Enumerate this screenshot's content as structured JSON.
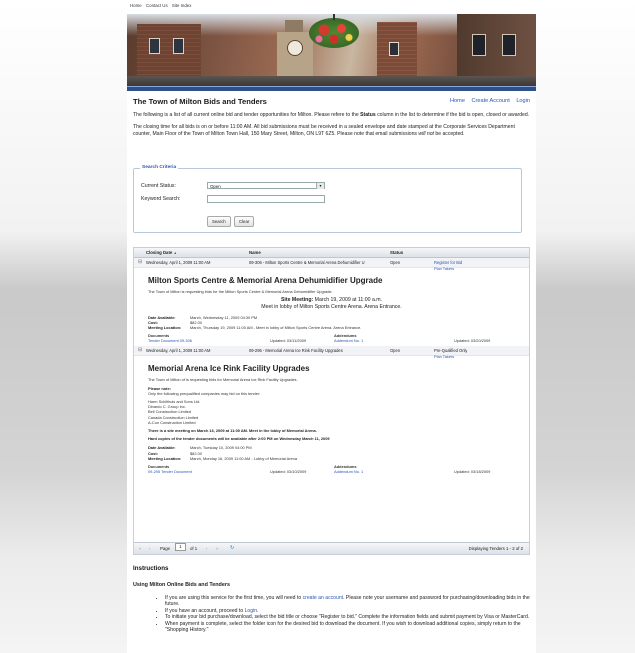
{
  "topnav": [
    "Home",
    "Contact Us",
    "Site Index"
  ],
  "page": {
    "title": "The Town of Milton Bids and Tenders",
    "links": [
      "Home",
      "Create Account",
      "Login"
    ],
    "intro1_before": "The following is a list of all current online bid and tender opportunities for Milton.  Please refere to the ",
    "intro1_bold": "Status",
    "intro1_after": " column in the list to determine if the bid is open, closed or awarded.",
    "intro2_before": "The closing time for all bids is on or before 11:00 AM.  All bid submissions must be received in a sealed envelope and date stamped at the Corporate Services Department counter, Main Floor of the Town of Milton Town Hall, 150 Mary Street, Milton, ON  L9T 6Z5.  Please note that email submissions ",
    "intro2_em": "will not",
    "intro2_after": " be accepted."
  },
  "search": {
    "legend": "Search Criteria",
    "status_label": "Current Status:",
    "status_value": "Open",
    "keyword_label": "Keyword Search:",
    "keyword_value": "",
    "search_btn": "Search",
    "clear_btn": "Clear"
  },
  "grid": {
    "columns": [
      "Closing Date",
      "Name",
      "Status",
      ""
    ],
    "sort_indicator": "▲"
  },
  "tenders": [
    {
      "closing": "Wednesday, April 1, 2009 11:00 AM",
      "name": "09-306 - Milton Sports Centre & Memorial Arena Dehumidifier U",
      "status": "Open",
      "action1": "Register for Bid",
      "action2": "Plan Takers",
      "title": "Milton Sports Centre & Memorial Arena Dehumidifier Upgrade",
      "description": "The Town of Milton is requesting bids for the Milton Sports Centre & Memorial Arena Dehumidifier Upgrade.",
      "meeting_label": "Site Meeting:",
      "meeting_when": "March 19, 2009 at 11:00 a.m.",
      "meeting_where": "Meet in lobby of Milton Sports Centre Arena.  Arena Entrance.",
      "date_available_label": "Date Available:",
      "date_available": "March, Wednesday 11, 2009 04:30 PM",
      "cost_label": "Cost:",
      "cost": "$82.00",
      "meeting_location_label": "Meeting Location:",
      "meeting_location": "March, Thursday 19, 2009 11:00 AM  -  Meet in lobby of Milton Sports Centre Arena. Arena Entrance.",
      "documents_label": "Documents",
      "document": "Tender Document 09-306",
      "doc_updated": "Updated: 03/11/2009",
      "addendums_label": "Addendums",
      "addendum": "Addendum No. 1",
      "add_updated": "Updated: 03/20/2009"
    },
    {
      "closing": "Wednesday, April 1, 2009 11:00 AM",
      "name": "09-295 - Memorial Arena Ice Rink Facility Upgrades",
      "status": "Open",
      "action1": "Pre-Qualified Only",
      "action2": "Plan Takers",
      "title": "Memorial Arena Ice Rink Facility Upgrades",
      "description": "The Town of Milton of is requesting bids for Memorial Arena Ice Rink Facility Upgrades.",
      "please_note": "Please note:",
      "prequal_line": "Only the following prequalified companies may bid on this tender:",
      "companies": [
        "Harm Schilthuis and Sons Ltd.",
        "Dinardo C. Group Inc.",
        "Bell Construction Limited",
        "Canada Construction Limited",
        "A-Con Construction Limited"
      ],
      "note1": "There is a site meeting on March 16, 2009 at 11:00 AM.  Meet in the lobby of Memorial Arena.",
      "note2": "Hard copies of the tender documents will be available after 2:00 PM on Wednesday March 11, 2009",
      "date_available_label": "Date Available:",
      "date_available": "March, Tuesday 10, 2009 04:00 PM",
      "cost_label": "Cost:",
      "cost": "$82.00",
      "meeting_location_label": "Meeting Location:",
      "meeting_location": "March, Monday 16, 2009 11:00 AM  -  Lobby of Memorial Arena",
      "documents_label": "Documents",
      "document": "09-295 Tender Document",
      "doc_updated": "Updated: 03/10/2009",
      "addendums_label": "Addendums",
      "addendum": "Addendum No. 1",
      "add_updated": "Updated: 03/18/2009"
    }
  ],
  "pager": {
    "page_label": "Page",
    "page_value": "1",
    "of_label": "of 1",
    "display": "Displaying Tenders 1 - 2 of 2"
  },
  "instructions": {
    "heading": "Instructions",
    "subheading": "Using Milton Online Bids and Tenders",
    "b1_before": "If you are using this service for the first time, you will need to ",
    "b1_link": "create an account",
    "b1_after": ". Please note your username and password for purchasing/downloading bids in the future.",
    "b2_before": "If you have an account, proceed to ",
    "b2_link": "Login",
    "b2_after": ".",
    "b3": "To initiate your bid purchase/download, select the bid title or choose \"Register to bid.\" Complete the information fields and submit payment by Visa or MasterCard.",
    "b4": "When payment is complete, select the folder icon for the desired bid to download the document. If you wish to download additional copies, simply return to the \"Shopping History.\""
  },
  "colors": {
    "accent": "#2f4f8a",
    "link": "#2a56b4"
  }
}
